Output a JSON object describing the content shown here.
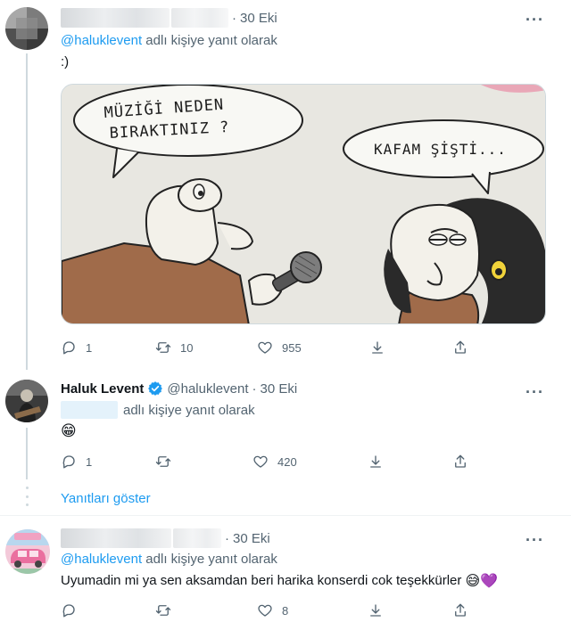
{
  "tweets": [
    {
      "date": "30 Eki",
      "reply_handle": "@haluklevent",
      "reply_suffix": "adlı kişiye yanıt olarak",
      "text": ":)",
      "media": {
        "bubble_left": [
          "MÜZİĞİ NEDEN",
          "BIRAKTINIZ ?"
        ],
        "bubble_right": "KAFAM ŞİŞTİ..."
      },
      "stats": {
        "replies": "1",
        "retweets": "10",
        "likes": "955"
      }
    },
    {
      "name": "Haluk Levent",
      "handle": "@haluklevent",
      "dot": "·",
      "date": "30 Eki",
      "reply_suffix": "adlı kişiye yanıt olarak",
      "text_emoji": "😁",
      "stats": {
        "replies": "1",
        "retweets": "",
        "likes": "420"
      }
    },
    {
      "date": "30 Eki",
      "reply_handle": "@haluklevent",
      "reply_suffix": "adlı kişiye yanıt olarak",
      "text": "Uyumadin mi ya sen aksamdan beri harika konserdi cok teşekkürler",
      "text_emoji": "😅💜",
      "stats": {
        "replies": "",
        "retweets": "",
        "likes": "8"
      }
    }
  ],
  "show_replies": "Yanıtları göster",
  "more_icon": "···",
  "dot": "·",
  "colors": {
    "link": "#1d9bf0",
    "muted": "#536471",
    "verified": "#1d9bf0"
  }
}
